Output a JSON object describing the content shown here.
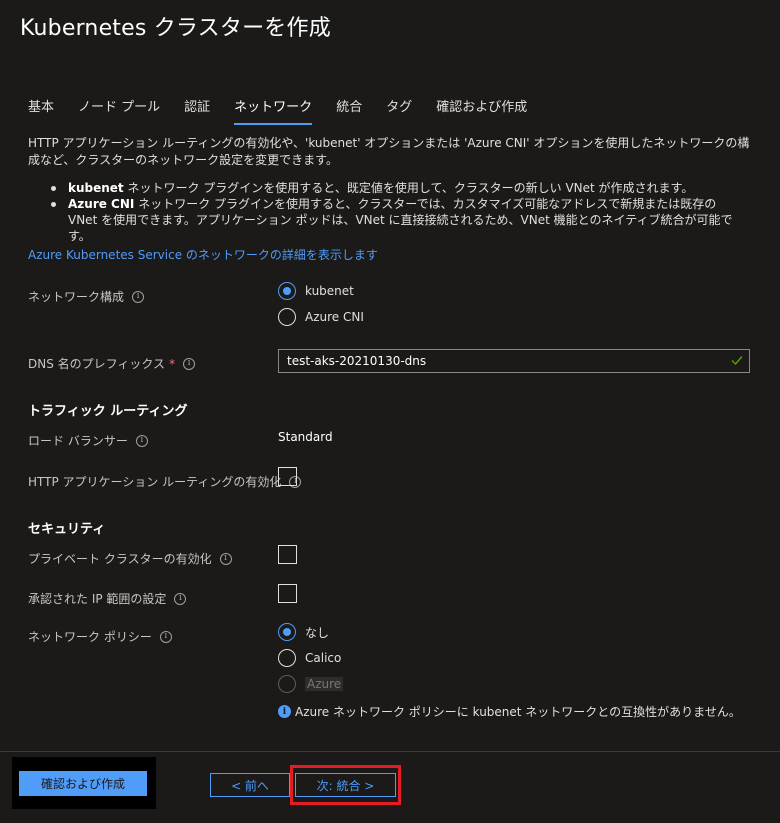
{
  "page": {
    "title": "Kubernetes クラスターを作成"
  },
  "tabs": [
    {
      "label": "基本"
    },
    {
      "label": "ノード プール"
    },
    {
      "label": "認証"
    },
    {
      "label": "ネットワーク",
      "active": true
    },
    {
      "label": "統合"
    },
    {
      "label": "タグ"
    },
    {
      "label": "確認および作成"
    }
  ],
  "intro": {
    "description": "HTTP アプリケーション ルーティングの有効化や、'kubenet' オプションまたは 'Azure CNI' オプションを使用したネットワークの構成など、クラスターのネットワーク設定を変更できます。",
    "bullet1_bold": "kubenet",
    "bullet1_text": " ネットワーク プラグインを使用すると、既定値を使用して、クラスターの新しい VNet が作成されます。",
    "bullet2_bold": "Azure CNI",
    "bullet2_text": " ネットワーク プラグインを使用すると、クラスターでは、カスタマイズ可能なアドレスで新規または既存の VNet を使用できます。アプリケーション ポッドは、VNet に直接接続されるため、VNet 機能とのネイティブ統合が可能です。",
    "link": "Azure Kubernetes Service のネットワークの詳細を表示します"
  },
  "network_config": {
    "label": "ネットワーク構成",
    "options": [
      "kubenet",
      "Azure CNI"
    ],
    "selected": "kubenet"
  },
  "dns": {
    "label": "DNS 名のプレフィックス",
    "required_mark": "*",
    "value": "test-aks-20210130-dns"
  },
  "traffic": {
    "heading": "トラフィック ルーティング",
    "lb_label": "ロード バランサー",
    "lb_value": "Standard",
    "http_label": "HTTP アプリケーション ルーティングの有効化",
    "http_checked": false
  },
  "security": {
    "heading": "セキュリティ",
    "private_label": "プライベート クラスターの有効化",
    "private_checked": false,
    "ip_label": "承認された IP 範囲の設定",
    "ip_checked": false,
    "policy_label": "ネットワーク ポリシー",
    "policy_options": [
      "なし",
      "Calico",
      "Azure"
    ],
    "policy_selected": "なし",
    "policy_disabled": "Azure",
    "note": "Azure ネットワーク ポリシーに kubenet ネットワークとの互換性がありません。"
  },
  "footer": {
    "review_create": "確認および作成",
    "prev": "< 前へ",
    "next": "次: 統合 >"
  },
  "colors": {
    "accent": "#4f9cf9",
    "background": "#1b1a19",
    "highlight": "#e41c24"
  }
}
